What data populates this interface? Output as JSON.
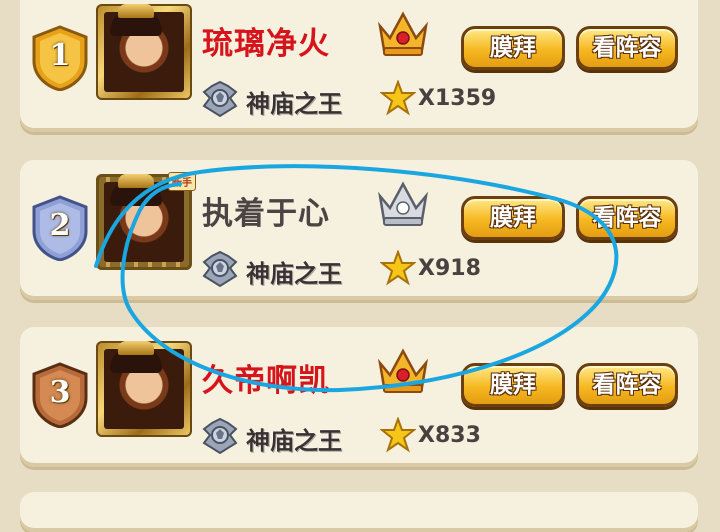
{
  "rows": [
    {
      "rank": "1",
      "name": "琉璃净火",
      "title": "神庙之王",
      "stars": "X1359",
      "worship_label": "膜拜",
      "lineup_label": "看阵容",
      "crown_icon": "gold-crown-icon",
      "badge_color": "#e8a21a",
      "name_color": "#d6141c"
    },
    {
      "rank": "2",
      "name": "执着于心",
      "new_tag": "新手",
      "title": "神庙之王",
      "stars": "X918",
      "worship_label": "膜拜",
      "lineup_label": "看阵容",
      "crown_icon": "silver-crown-icon",
      "badge_color": "#8ea0d6",
      "name_color": "#4a4444"
    },
    {
      "rank": "3",
      "name": "久帝啊凯",
      "title": "神庙之王",
      "stars": "X833",
      "worship_label": "膜拜",
      "lineup_label": "看阵容",
      "crown_icon": "gold-crown-icon",
      "badge_color": "#b86b3a",
      "name_color": "#d6141c"
    }
  ],
  "annotation": {
    "color": "#1aa6e0"
  }
}
